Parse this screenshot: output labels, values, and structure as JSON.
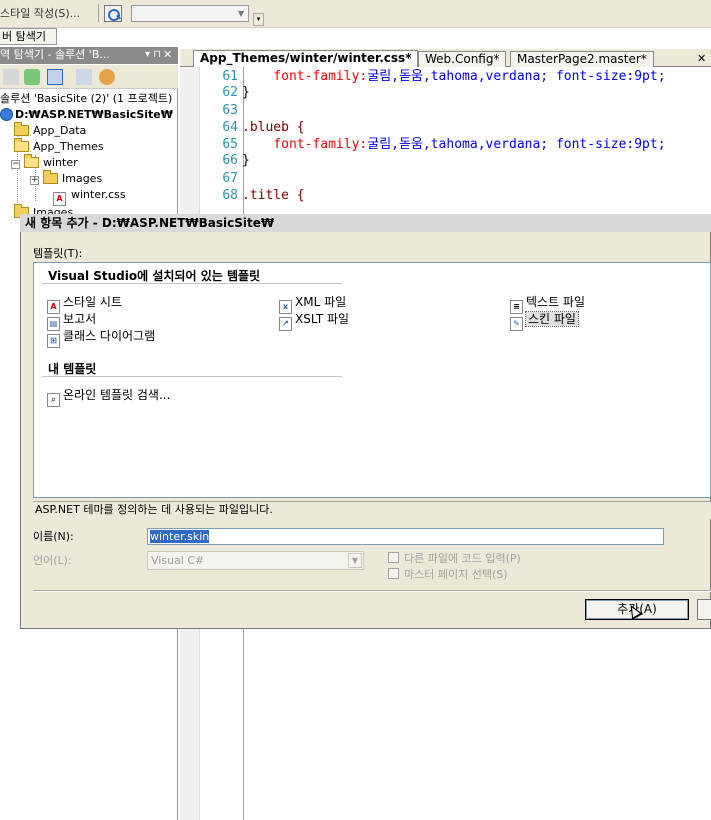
{
  "toolbar": {
    "menu_text": "스타일 작성(S)...",
    "combo_value": ""
  },
  "solution_explorer": {
    "tab_label": "버 탐색기",
    "header": "역 탐색기 - 솔루션 'B...",
    "pin": "▾ ⊓",
    "close": "✕",
    "items": [
      {
        "label": "솔루션 'BasicSite (2)' (1 프로젝트)"
      },
      {
        "label": "D:₩ASP.NET₩BasicSite₩"
      },
      {
        "label": "App_Data"
      },
      {
        "label": "App_Themes"
      },
      {
        "label": "winter"
      },
      {
        "label": "Images"
      },
      {
        "label": "winter.css"
      },
      {
        "label": "Images"
      }
    ]
  },
  "editor": {
    "tabs": [
      {
        "label": "App_Themes/winter/winter.css*"
      },
      {
        "label": "Web.Config*"
      },
      {
        "label": "MasterPage2.master*"
      }
    ],
    "close_glyph": "✕",
    "lines": [
      {
        "num": "61",
        "indent": "    ",
        "prop": "font-family:",
        "value": "굴림,돋움,tahoma,verdana; font-size:9pt;",
        "selector": ""
      },
      {
        "num": "62",
        "indent": "",
        "prop": "",
        "value": "",
        "selector": "}"
      },
      {
        "num": "63",
        "indent": "",
        "prop": "",
        "value": "",
        "selector": ""
      },
      {
        "num": "64",
        "indent": "",
        "prop": "",
        "value": "",
        "selector": ".blueb {"
      },
      {
        "num": "65",
        "indent": "    ",
        "prop": "font-family:",
        "value": "굴림,돋움,tahoma,verdana; font-size:9pt;",
        "selector": ""
      },
      {
        "num": "66",
        "indent": "",
        "prop": "",
        "value": "",
        "selector": "}"
      },
      {
        "num": "67",
        "indent": "",
        "prop": "",
        "value": "",
        "selector": ""
      },
      {
        "num": "68",
        "indent": "",
        "prop": "",
        "value": "",
        "selector": ".title {"
      }
    ]
  },
  "dialog": {
    "title": "새 항목 추가 - D:₩ASP.NET₩BasicSite₩",
    "templates_label": "템플릿(T):",
    "installed_group": "Visual Studio에 설치되어 있는 템플릿",
    "my_group": "내 템플릿",
    "templates": [
      {
        "label": "스타일 시트",
        "icon": "stylesheet-icon"
      },
      {
        "label": "XML 파일",
        "icon": "xml-file-icon"
      },
      {
        "label": "텍스트 파일",
        "icon": "text-file-icon"
      },
      {
        "label": "보고서",
        "icon": "report-icon"
      },
      {
        "label": "XSLT 파일",
        "icon": "xslt-file-icon"
      },
      {
        "label": "스킨 파일",
        "icon": "skin-file-icon",
        "selected": true
      },
      {
        "label": "클래스 다이어그램",
        "icon": "class-diagram-icon"
      }
    ],
    "my_templates": [
      {
        "label": "온라인 템플릿 검색...",
        "icon": "online-search-icon"
      }
    ],
    "description": "ASP.NET 테마를 정의하는 데 사용되는 파일입니다.",
    "name_label": "이름(N):",
    "name_value": "winter.skin",
    "language_label": "언어(L):",
    "language_value": "Visual C#",
    "checkbox_code": "다른 파일에 코드 입력(P)",
    "checkbox_master": "마스터 페이지 선택(S)",
    "add_button": "추가(A)"
  }
}
